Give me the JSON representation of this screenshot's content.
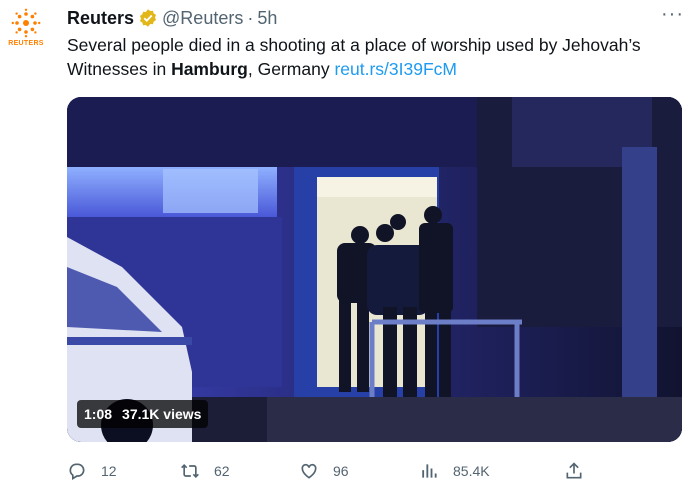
{
  "account": {
    "name": "Reuters",
    "handle": "@Reuters",
    "separator": "·",
    "time": "5h",
    "avatar_text": "REUTERS"
  },
  "tweet": {
    "text_before": "Several people died in a shooting at a place of worship used by Jehovah’s Witnesses in ",
    "text_bold": "Hamburg",
    "text_after": ", Germany ",
    "link": "reut.rs/3I39FcM"
  },
  "video": {
    "duration": "1:08",
    "views": "37.1K views"
  },
  "actions": {
    "replies": "12",
    "retweets": "62",
    "likes": "96",
    "views": "85.4K"
  },
  "colors": {
    "link": "#1d9bf0",
    "verified": "#e2b719",
    "muted": "#536471"
  },
  "icons": [
    "reuters-logo-icon",
    "verified-badge-icon",
    "more-icon",
    "reply-icon",
    "retweet-icon",
    "like-icon",
    "views-icon",
    "share-icon"
  ]
}
